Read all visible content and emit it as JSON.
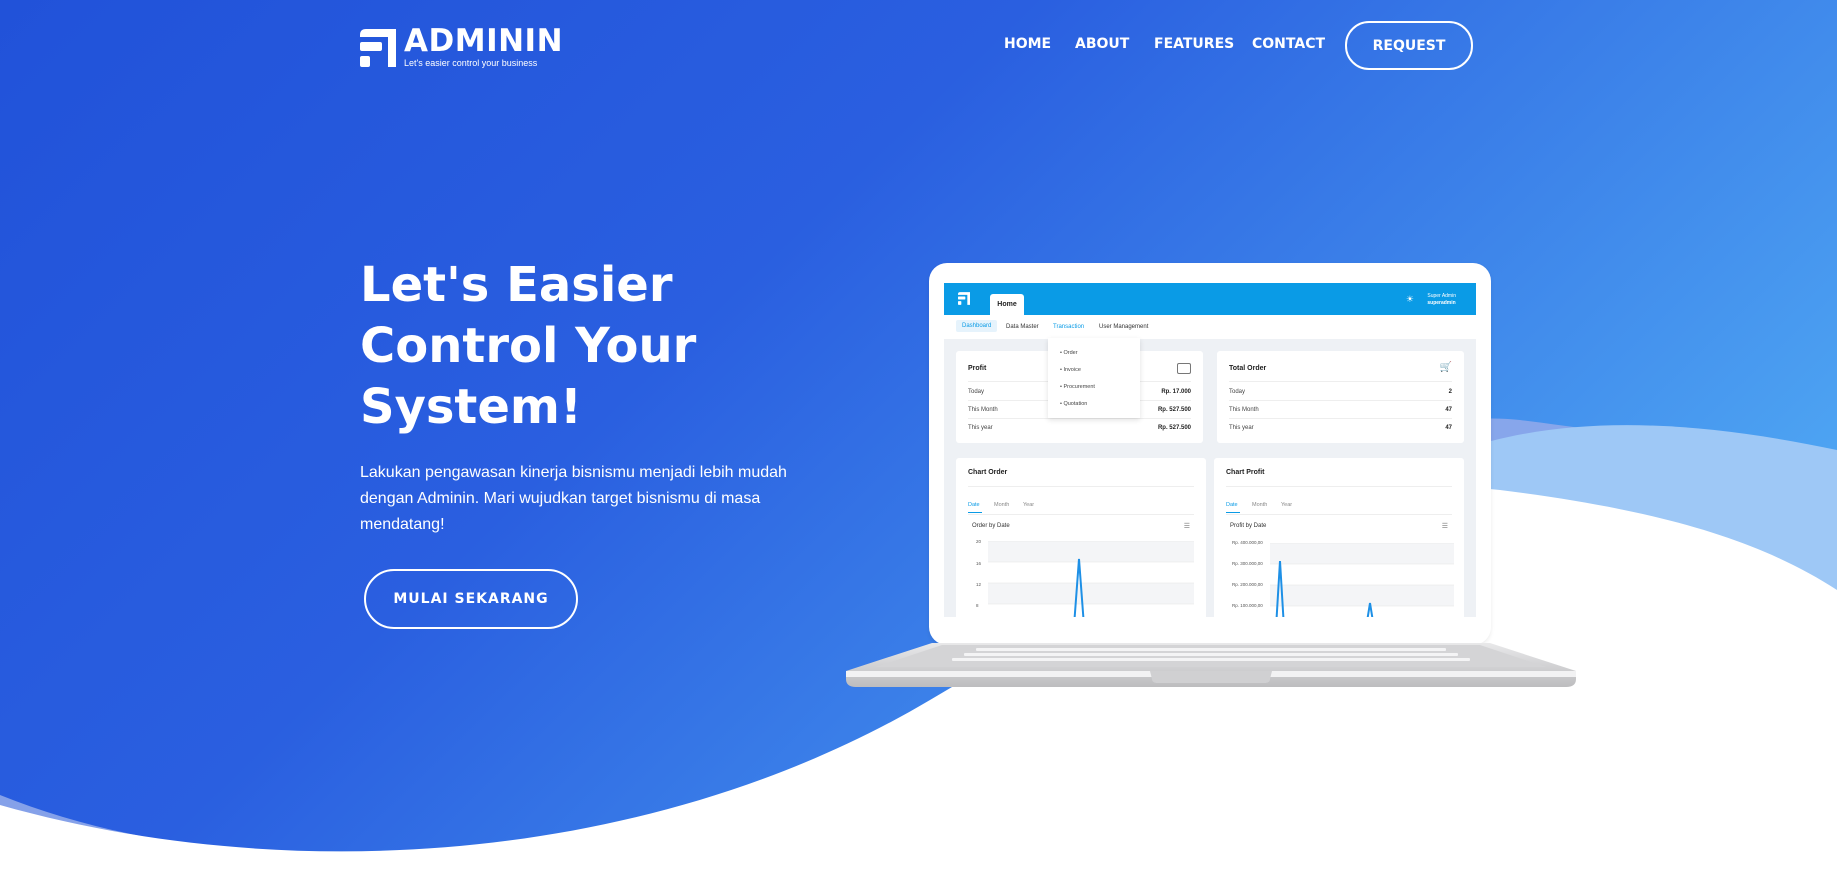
{
  "brand": {
    "name": "ADMININ",
    "tagline": "Let's easier control your business"
  },
  "nav": {
    "items": [
      {
        "label": "HOME"
      },
      {
        "label": "ABOUT"
      },
      {
        "label": "FEATURES"
      },
      {
        "label": "CONTACT"
      }
    ],
    "request_label": "REQUEST"
  },
  "hero": {
    "title_line1": "Let's Easier",
    "title_line2": "Control Your",
    "title_line3": "System!",
    "description": "Lakukan pengawasan kinerja bisnismu menjadi lebih mudah dengan Adminin. Mari wujudkan target bisnismu di masa mendatang!",
    "cta_label": "MULAI SEKARANG"
  },
  "colors": {
    "primary_dark": "#2152d9",
    "primary_light": "#4da3f2",
    "wave_light": "#9ec8f6",
    "screen_header": "#0a9be6"
  },
  "mockup": {
    "home_tab": "Home",
    "user_name": "Super Admin",
    "user_handle": "superadmin",
    "subnav": [
      "Dashboard",
      "Data Master",
      "Transaction",
      "User Management"
    ],
    "dropdown": [
      "Order",
      "Invoice",
      "Procurement",
      "Quotation"
    ],
    "profit": {
      "title": "Profit",
      "rows": [
        {
          "label": "Today",
          "value": "Rp. 17.000"
        },
        {
          "label": "This Month",
          "value": "Rp. 527.500"
        },
        {
          "label": "This year",
          "value": "Rp. 527.500"
        }
      ]
    },
    "total_order": {
      "title": "Total Order",
      "rows": [
        {
          "label": "Today",
          "value": "2"
        },
        {
          "label": "This Month",
          "value": "47"
        },
        {
          "label": "This year",
          "value": "47"
        }
      ]
    },
    "chart_order": {
      "title": "Chart Order",
      "tabs": [
        "Date",
        "Month",
        "Year"
      ],
      "subtitle": "Order by Date",
      "yticks": [
        "20",
        "16",
        "12",
        "8"
      ]
    },
    "chart_profit": {
      "title": "Chart Profit",
      "tabs": [
        "Date",
        "Month",
        "Year"
      ],
      "subtitle": "Profit by Date",
      "yticks": [
        "Rp. 400.000,00",
        "Rp. 300.000,00",
        "Rp. 200.000,00",
        "Rp. 100.000,00"
      ]
    }
  }
}
